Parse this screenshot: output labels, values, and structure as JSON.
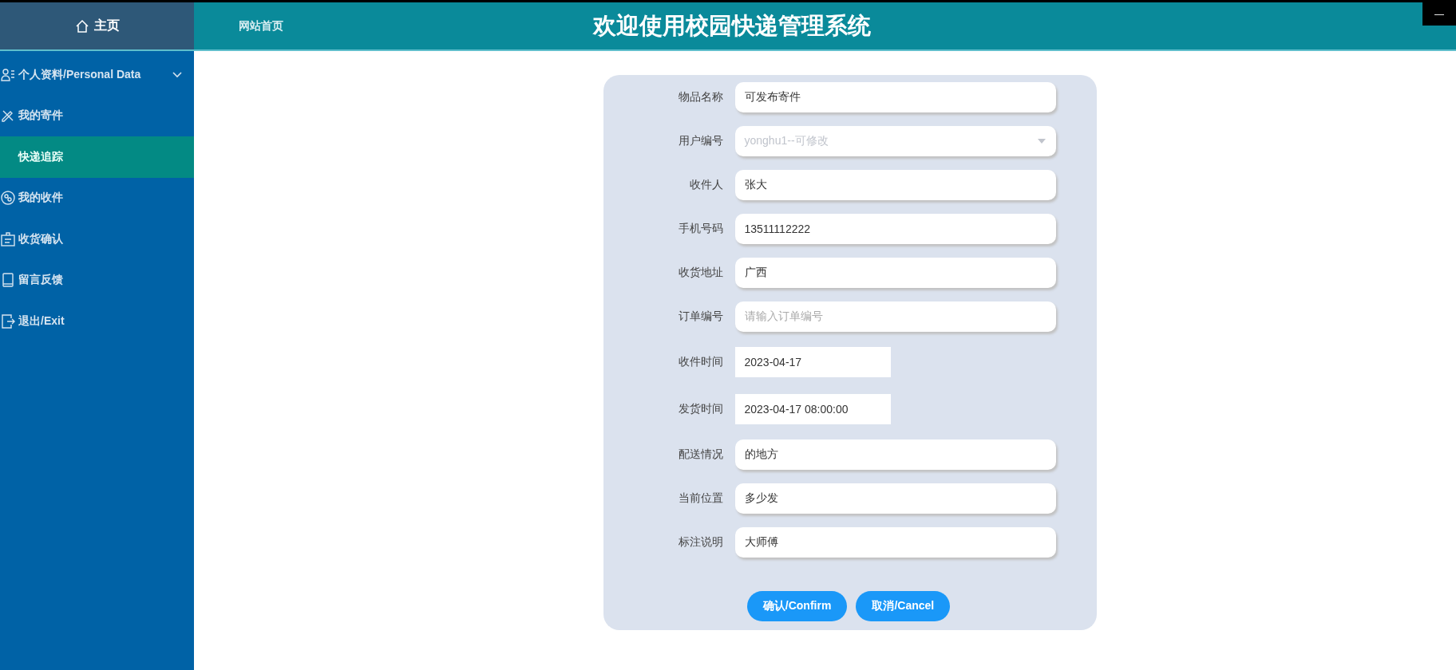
{
  "sidebar": {
    "home": "主页",
    "items": [
      {
        "label": "个人资料/Personal Data",
        "kind": "group",
        "selected": false
      },
      {
        "label": "我的寄件",
        "kind": "link",
        "selected": false
      },
      {
        "label": "快递追踪",
        "kind": "subitem",
        "selected": true
      },
      {
        "label": "我的收件",
        "kind": "link",
        "selected": false
      },
      {
        "label": "收货确认",
        "kind": "link",
        "selected": false
      },
      {
        "label": "留言反馈",
        "kind": "link",
        "selected": false
      },
      {
        "label": "退出/Exit",
        "kind": "link",
        "selected": false
      }
    ]
  },
  "header": {
    "nav_link": "网站首页",
    "title": "欢迎使用校园快递管理系统",
    "window_button": "—"
  },
  "form": {
    "fields": [
      {
        "label": "物品名称",
        "kind": "text",
        "value": "可发布寄件"
      },
      {
        "label": "用户编号",
        "kind": "select",
        "placeholder": "yonghu1--可修改"
      },
      {
        "label": "收件人",
        "kind": "text",
        "value": "张大"
      },
      {
        "label": "手机号码",
        "kind": "text",
        "value": "13511112222"
      },
      {
        "label": "收货地址",
        "kind": "text",
        "value": "广西"
      },
      {
        "label": "订单编号",
        "kind": "text",
        "placeholder": "请输入订单编号"
      },
      {
        "label": "收件时间",
        "kind": "date",
        "value": "2023-04-17"
      },
      {
        "label": "发货时间",
        "kind": "date",
        "value": "2023-04-17 08:00:00"
      },
      {
        "label": "配送情况",
        "kind": "text",
        "value": "的地方"
      },
      {
        "label": "当前位置",
        "kind": "text",
        "value": "多少发"
      },
      {
        "label": "标注说明",
        "kind": "text",
        "value": "大师傅"
      }
    ],
    "buttons": [
      "确认/Confirm",
      "取消/Cancel"
    ]
  }
}
